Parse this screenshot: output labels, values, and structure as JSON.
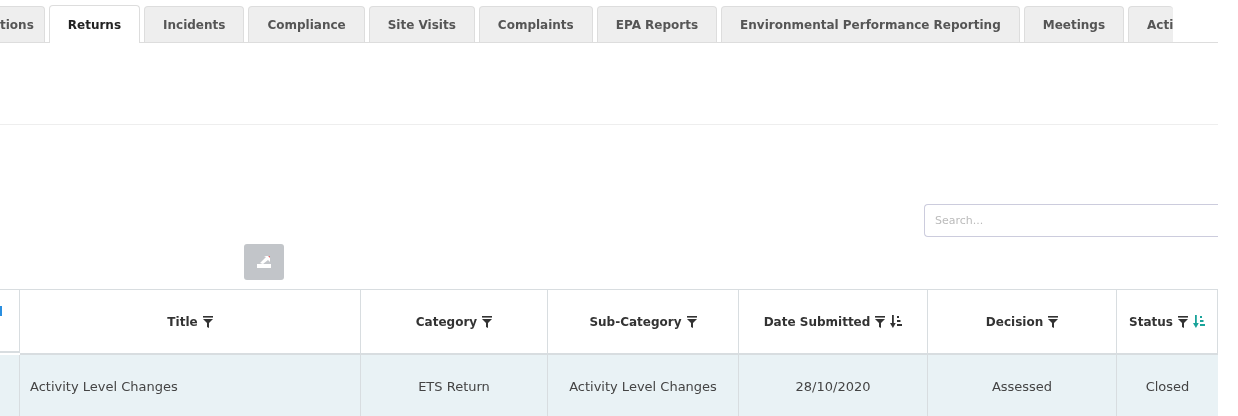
{
  "tabs": [
    {
      "label": "tions",
      "selected": false
    },
    {
      "label": "Returns",
      "selected": true
    },
    {
      "label": "Incidents",
      "selected": false
    },
    {
      "label": "Compliance",
      "selected": false
    },
    {
      "label": "Site Visits",
      "selected": false
    },
    {
      "label": "Complaints",
      "selected": false
    },
    {
      "label": "EPA Reports",
      "selected": false
    },
    {
      "label": "Environmental Performance Reporting",
      "selected": false
    },
    {
      "label": "Meetings",
      "selected": false
    },
    {
      "label": "Acti",
      "selected": false
    }
  ],
  "search": {
    "placeholder": "Search..."
  },
  "table": {
    "columns": [
      {
        "kind": "selector"
      },
      {
        "kind": "filter",
        "label": "Title"
      },
      {
        "kind": "filter",
        "label": "Category"
      },
      {
        "kind": "filter",
        "label": "Sub-Category"
      },
      {
        "kind": "sortable",
        "label": "Date Submitted",
        "sorted": false
      },
      {
        "kind": "filter",
        "label": "Decision"
      },
      {
        "kind": "sortable",
        "label": "Status",
        "sorted": true
      }
    ],
    "rows": [
      {
        "selected": true,
        "cells": [
          "",
          "Activity Level Changes",
          "ETS Return",
          "Activity Level Changes",
          "28/10/2020",
          "Assessed",
          "Closed"
        ]
      }
    ]
  }
}
